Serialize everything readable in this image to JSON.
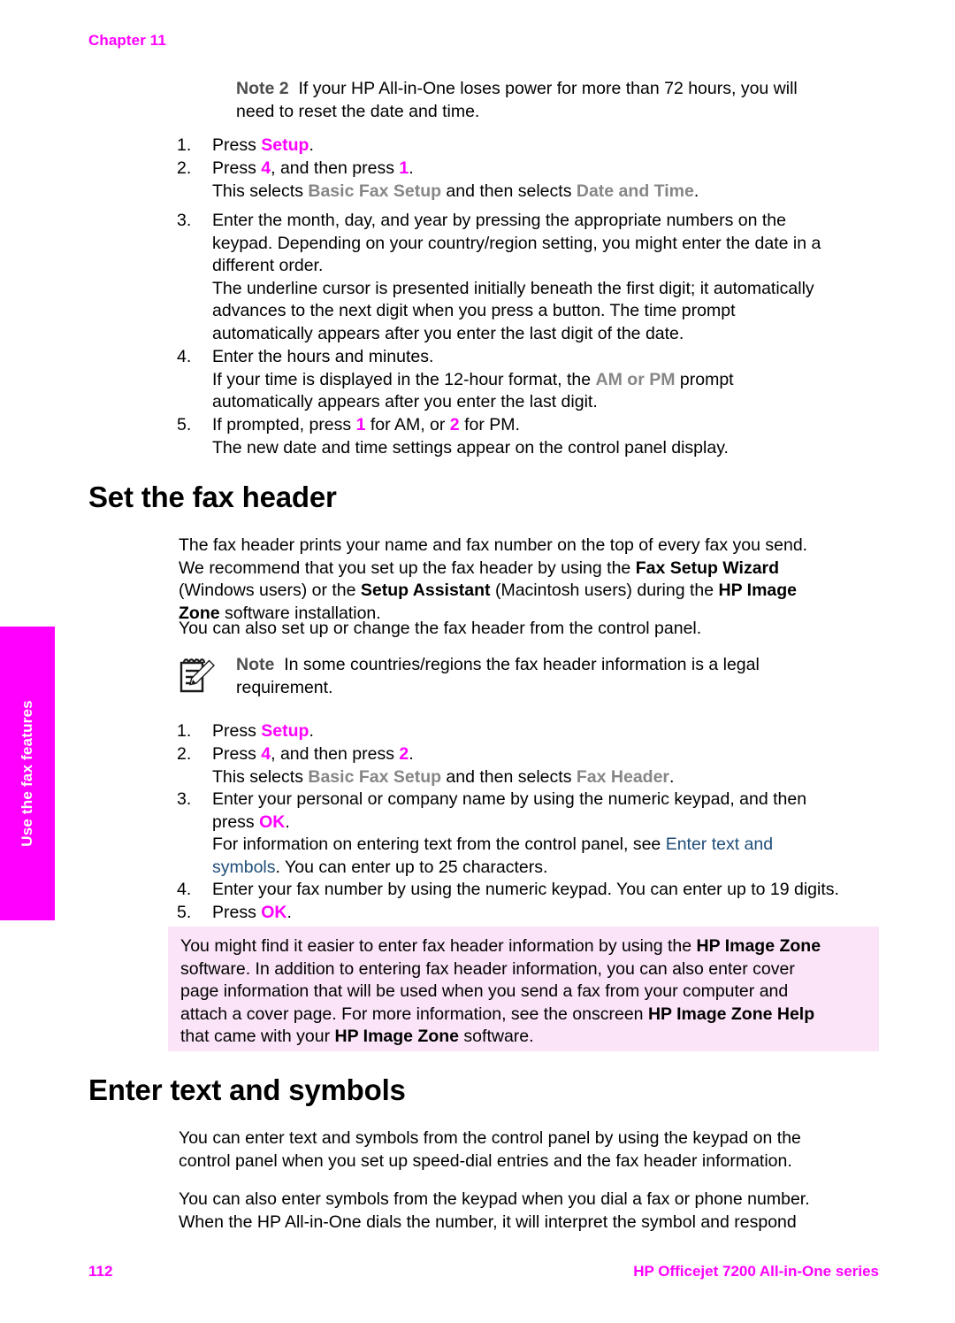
{
  "meta": {
    "chapter_label": "Chapter 11",
    "side_tab_label": "Use the fax features",
    "page_number": "112",
    "footer_title": "HP Officejet 7200 All-in-One series",
    "accent_magenta": "#ff00ff",
    "menu_gray": "#868686",
    "link_blue": "#1f4e79",
    "tip_box_bg": "#fbe4f7"
  },
  "note_top": {
    "label": "Note 2",
    "line1": "If your HP All-in-One loses power for more than 72 hours, you will",
    "line2": "need to reset the date and time."
  },
  "datetime_steps": {
    "s1_num": "1.",
    "s1_a": "Press ",
    "s1_kw": "Setup",
    "s1_b": ".",
    "s2_num": "2.",
    "s2_a": "Press ",
    "s2_kw1": "4",
    "s2_b": ", and then press ",
    "s2_kw2": "1",
    "s2_c": ".",
    "s2_sub_a": "This selects ",
    "s2_sub_menu1": "Basic Fax Setup",
    "s2_sub_b": " and then selects ",
    "s2_sub_menu2": "Date and Time",
    "s2_sub_c": ".",
    "s3_num": "3.",
    "s3_l1": "Enter the month, day, and year by pressing the appropriate numbers on the",
    "s3_l2": "keypad. Depending on your country/region setting, you might enter the date in a",
    "s3_l3": "different order.",
    "s3_l4": "The underline cursor is presented initially beneath the first digit; it automatically",
    "s3_l5": "advances to the next digit when you press a button. The time prompt",
    "s3_l6": "automatically appears after you enter the last digit of the date.",
    "s4_num": "4.",
    "s4_l1": "Enter the hours and minutes.",
    "s4_l2_a": "If your time is displayed in the 12-hour format, the ",
    "s4_l2_menu": "AM or PM",
    "s4_l2_b": " prompt",
    "s4_l3": "automatically appears after you enter the last digit.",
    "s5_num": "5.",
    "s5_a": "If prompted, press ",
    "s5_kw1": "1",
    "s5_b": " for AM, or ",
    "s5_kw2": "2",
    "s5_c": " for PM.",
    "s5_sub": "The new date and time settings appear on the control panel display."
  },
  "section_fax_header": {
    "heading": "Set the fax header",
    "p1_l1": "The fax header prints your name and fax number on the top of every fax you send.",
    "p1_l2_a": "We recommend that you set up the fax header by using the ",
    "p1_l2_b": "Fax Setup Wizard",
    "p1_l3_a": "(Windows users) or the ",
    "p1_l3_b": "Setup Assistant",
    "p1_l3_c": " (Macintosh users) during the ",
    "p1_l3_d": "HP Image",
    "p1_l4_a": "Zone",
    "p1_l4_b": " software installation.",
    "p2": "You can also set up or change the fax header from the control panel.",
    "note_icon_name": "notepad-pencil-icon",
    "note_label": "Note",
    "note_l1": "In some countries/regions the fax header information is a legal",
    "note_l2": "requirement."
  },
  "fax_header_steps": {
    "s1_num": "1.",
    "s1_a": "Press ",
    "s1_kw": "Setup",
    "s1_b": ".",
    "s2_num": "2.",
    "s2_a": "Press ",
    "s2_kw1": "4",
    "s2_b": ", and then press ",
    "s2_kw2": "2",
    "s2_c": ".",
    "s2_sub_a": "This selects ",
    "s2_sub_menu1": "Basic Fax Setup",
    "s2_sub_b": " and then selects ",
    "s2_sub_menu2": "Fax Header",
    "s2_sub_c": ".",
    "s3_num": "3.",
    "s3_l1": "Enter your personal or company name by using the numeric keypad, and then",
    "s3_l2_a": "press ",
    "s3_l2_kw": "OK",
    "s3_l2_b": ".",
    "s3_l3_a": "For information on entering text from the control panel, see ",
    "s3_l3_link": "Enter text and",
    "s3_l4_link": "symbols",
    "s3_l4_b": ". You can enter up to 25 characters.",
    "s4_num": "4.",
    "s4_l1": "Enter your fax number by using the numeric keypad. You can enter up to 19 digits.",
    "s5_num": "5.",
    "s5_a": "Press ",
    "s5_kw": "OK",
    "s5_b": "."
  },
  "tip_box": {
    "l1_a": "You might find it easier to enter fax header information by using the ",
    "l1_b": "HP Image Zone",
    "l2": "software. In addition to entering fax header information, you can also enter cover",
    "l3": "page information that will be used when you send a fax from your computer and",
    "l4_a": "attach a cover page. For more information, see the onscreen ",
    "l4_b": "HP Image Zone Help",
    "l5_a": "that came with your ",
    "l5_b": "HP Image Zone",
    "l5_c": " software."
  },
  "section_enter_text": {
    "heading": "Enter text and symbols",
    "p1_l1": "You can enter text and symbols from the control panel by using the keypad on the",
    "p1_l2": "control panel when you set up speed-dial entries and the fax header information.",
    "p2_l1": "You can also enter symbols from the keypad when you dial a fax or phone number.",
    "p2_l2": "When the HP All-in-One dials the number, it will interpret the symbol and respond"
  }
}
